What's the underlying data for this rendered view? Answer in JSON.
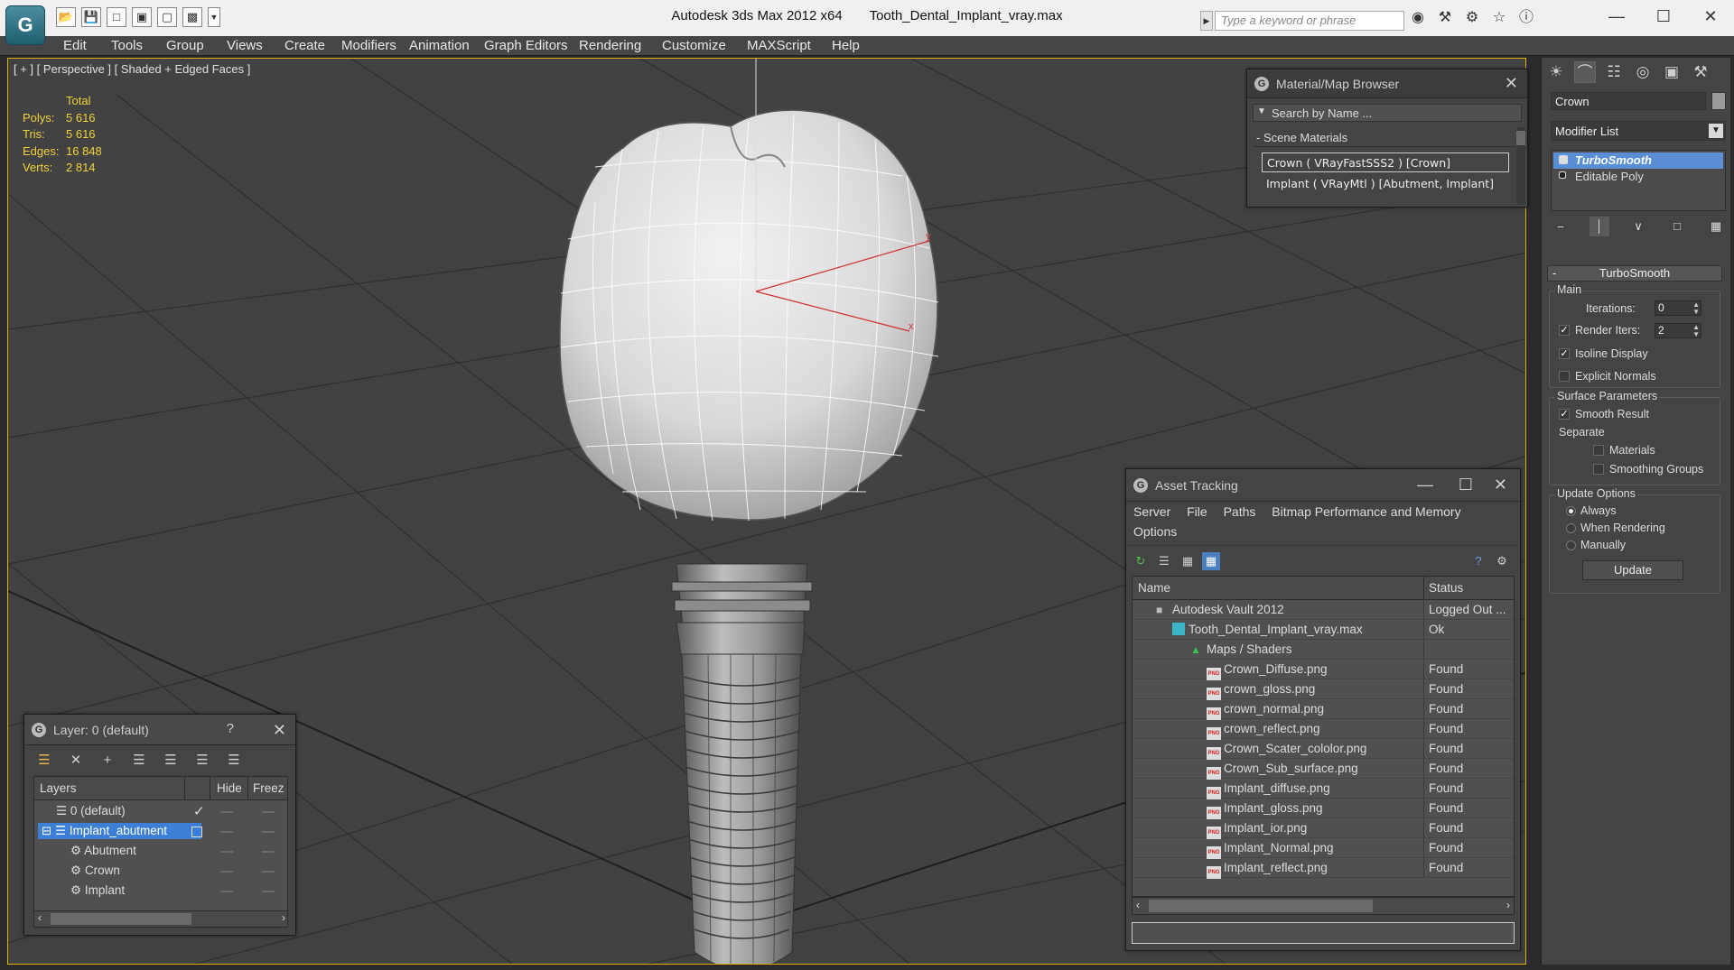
{
  "title_bar": {
    "app_title": "Autodesk 3ds Max  2012 x64",
    "file_name": "Tooth_Dental_Implant_vray.max",
    "search_placeholder": "Type a keyword or phrase",
    "logo_glyph": "G"
  },
  "menu": [
    "Edit",
    "Tools",
    "Group",
    "Views",
    "Create",
    "Modifiers",
    "Animation",
    "Graph Editors",
    "Rendering",
    "Customize",
    "MAXScript",
    "Help"
  ],
  "viewport": {
    "label": "[ + ] [ Perspective ] [ Shaded + Edged Faces ]",
    "stats": {
      "header": "Total",
      "rows": [
        {
          "label": "Polys:",
          "value": "5 616"
        },
        {
          "label": "Tris:",
          "value": "5 616"
        },
        {
          "label": "Edges:",
          "value": "16 848"
        },
        {
          "label": "Verts:",
          "value": "2 814"
        }
      ]
    },
    "gizmo_labels": {
      "y": "y",
      "x": "x"
    }
  },
  "material_browser": {
    "title": "Material/Map Browser",
    "search_placeholder": "Search by Name ...",
    "group": "- Scene Materials",
    "entries": [
      "Crown  ( VRayFastSSS2 ) [Crown]",
      "Implant  ( VRayMtl ) [Abutment, Implant]"
    ]
  },
  "command_panel": {
    "object_name": "Crown",
    "modifier_list": "Modifier List",
    "stack": [
      "TurboSmooth",
      "Editable Poly"
    ],
    "turbosmooth": {
      "title": "TurboSmooth",
      "main_group": "Main",
      "iterations_label": "Iterations:",
      "iterations_value": "0",
      "render_iters_label": "Render Iters:",
      "render_iters_value": "2",
      "isoline_label": "Isoline Display",
      "explicit_normals_label": "Explicit Normals",
      "surface_group": "Surface Parameters",
      "smooth_result_label": "Smooth Result",
      "separate_label": "Separate",
      "materials_label": "Materials",
      "smoothing_groups_label": "Smoothing Groups",
      "update_group": "Update Options",
      "always_label": "Always",
      "when_rendering_label": "When Rendering",
      "manually_label": "Manually",
      "update_button": "Update"
    },
    "checks": {
      "render_iters": true,
      "isoline": true,
      "explicit_normals": false,
      "smooth_result": true,
      "materials": false,
      "smoothing_groups": false
    },
    "update_option": "Always"
  },
  "asset_tracking": {
    "title": "Asset Tracking",
    "menu": [
      "Server",
      "File",
      "Paths",
      "Bitmap Performance and Memory",
      "Options"
    ],
    "columns": {
      "name": "Name",
      "status": "Status"
    },
    "rows": [
      {
        "name": "Autodesk Vault 2012",
        "status": "Logged Out ..."
      },
      {
        "name": "Tooth_Dental_Implant_vray.max",
        "status": "Ok"
      },
      {
        "name": "Maps / Shaders",
        "status": ""
      },
      {
        "name": "Crown_Diffuse.png",
        "status": "Found"
      },
      {
        "name": "crown_gloss.png",
        "status": "Found"
      },
      {
        "name": "crown_normal.png",
        "status": "Found"
      },
      {
        "name": "crown_reflect.png",
        "status": "Found"
      },
      {
        "name": "Crown_Scater_cololor.png",
        "status": "Found"
      },
      {
        "name": "Crown_Sub_surface.png",
        "status": "Found"
      },
      {
        "name": "Implant_diffuse.png",
        "status": "Found"
      },
      {
        "name": "Implant_gloss.png",
        "status": "Found"
      },
      {
        "name": "Implant_ior.png",
        "status": "Found"
      },
      {
        "name": "Implant_Normal.png",
        "status": "Found"
      },
      {
        "name": "Implant_reflect.png",
        "status": "Found"
      }
    ],
    "png_icon_label": "PNG"
  },
  "layer_manager": {
    "title": "Layer: 0 (default)",
    "help": "?",
    "columns": {
      "layers": "Layers",
      "hide": "Hide",
      "freeze": "Freez"
    },
    "rows": [
      {
        "name": "0 (default)"
      },
      {
        "name": "Implant_abutment"
      },
      {
        "name": "Abutment"
      },
      {
        "name": "Crown"
      },
      {
        "name": "Implant"
      }
    ]
  },
  "colors": {
    "stats_yellow": "#f0d23a",
    "selection_blue": "#3d7fd6",
    "viewport_bg": "#424242",
    "active_viewport_border": "#e2b100"
  }
}
